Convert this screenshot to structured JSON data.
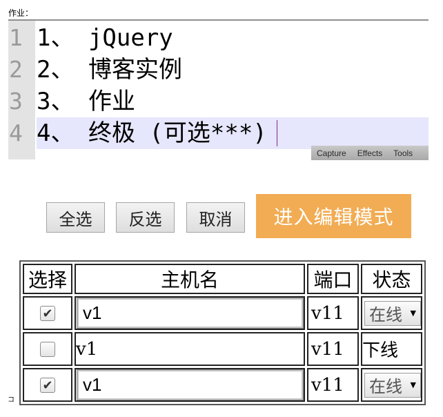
{
  "page_label": "作业：",
  "editor": {
    "lines": [
      {
        "num": "1",
        "text": "1、 jQuery"
      },
      {
        "num": "2",
        "text": "2、 博客实例"
      },
      {
        "num": "3",
        "text": "3、 作业"
      },
      {
        "num": "4",
        "text": "4、 终极 (可选***)"
      }
    ],
    "active_line": 4
  },
  "toolbar": {
    "capture": "Capture",
    "effects": "Effects",
    "tools": "Tools"
  },
  "buttons": {
    "select_all": "全选",
    "invert": "反选",
    "cancel": "取消",
    "edit_mode": "进入编辑模式"
  },
  "table": {
    "headers": [
      "选择",
      "主机名",
      "端口",
      "状态"
    ],
    "rows": [
      {
        "checked": true,
        "host": "v1",
        "port": "v11",
        "status": "在线",
        "editing": true
      },
      {
        "checked": false,
        "host": "v1",
        "port": "v11",
        "status": "下线",
        "editing": false
      },
      {
        "checked": true,
        "host": "v1",
        "port": "v11",
        "status": "在线",
        "editing": true
      }
    ]
  },
  "stray_glyph": "コ",
  "colors": {
    "edit_button": "#f2ac53",
    "active_line": "#e6e6fc",
    "gutter": "#e3e3e3"
  }
}
